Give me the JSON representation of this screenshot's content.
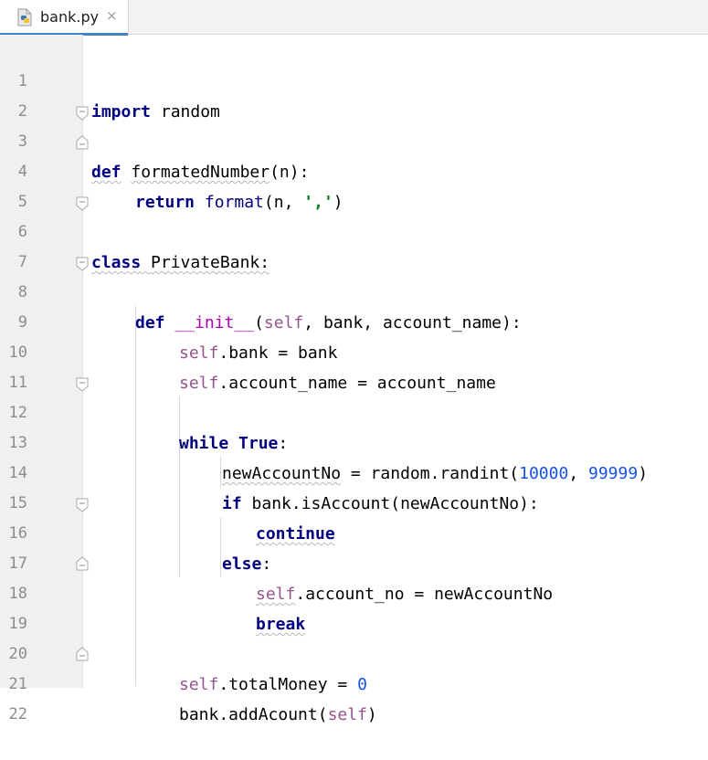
{
  "tab": {
    "filename": "bank.py",
    "close": "×"
  },
  "lines": [
    {
      "n": "1"
    },
    {
      "n": "2"
    },
    {
      "n": "3"
    },
    {
      "n": "4"
    },
    {
      "n": "5"
    },
    {
      "n": "6"
    },
    {
      "n": "7"
    },
    {
      "n": "8"
    },
    {
      "n": "9"
    },
    {
      "n": "10"
    },
    {
      "n": "11"
    },
    {
      "n": "12"
    },
    {
      "n": "13"
    },
    {
      "n": "14"
    },
    {
      "n": "15"
    },
    {
      "n": "16"
    },
    {
      "n": "17"
    },
    {
      "n": "18"
    },
    {
      "n": "19"
    },
    {
      "n": "20"
    },
    {
      "n": "21"
    },
    {
      "n": "22"
    }
  ],
  "tokens": {
    "l1": [
      "import",
      " random"
    ],
    "l3": [
      "def",
      " ",
      "formatedNumber",
      "(n):"
    ],
    "l4": [
      "return",
      " ",
      "format",
      "(n, ",
      "','",
      ")"
    ],
    "l6": [
      "class",
      " ",
      "PrivateBank",
      ":"
    ],
    "l8": [
      "def",
      " ",
      "__init__",
      "(",
      "self",
      ", bank, account_name):"
    ],
    "l9": [
      "self",
      ".bank = bank"
    ],
    "l10": [
      "self",
      ".account_name = account_name"
    ],
    "l12": [
      "while",
      " ",
      "True",
      ":"
    ],
    "l13": [
      "newAccountNo",
      " = random.randint(",
      "10000",
      ", ",
      "99999",
      ")"
    ],
    "l14": [
      "if",
      " bank.isAccount(newAccountNo):"
    ],
    "l15": [
      "continue"
    ],
    "l16": [
      "else",
      ":"
    ],
    "l17": [
      "self",
      ".account_no = newAccountNo"
    ],
    "l18": [
      "break"
    ],
    "l20": [
      "self",
      ".totalMoney = ",
      "0"
    ],
    "l21": [
      "bank.addAcount(",
      "self",
      ")"
    ]
  }
}
